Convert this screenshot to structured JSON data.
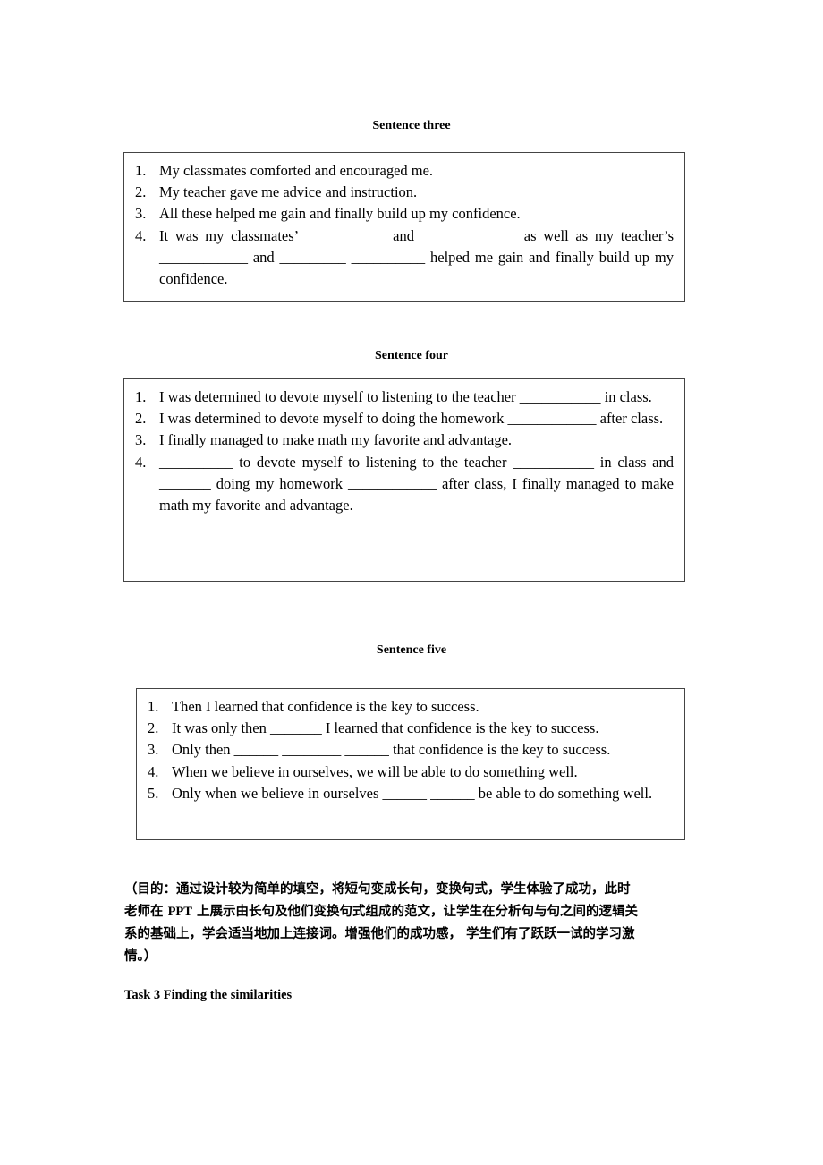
{
  "sections": [
    {
      "heading": "Sentence three",
      "items": [
        {
          "num": "1.",
          "text": "My classmates comforted and encouraged me."
        },
        {
          "num": "2.",
          "text": "My teacher gave me advice and instruction."
        },
        {
          "num": "3.",
          "text": "All these helped me gain and finally build up my confidence."
        },
        {
          "num": "4.",
          "text": "It was my classmates’ ___________ and _____________ as well as my teacher’s ____________ and _________ __________ helped me gain and finally build up my confidence."
        }
      ]
    },
    {
      "heading": "Sentence four",
      "items": [
        {
          "num": "1.",
          "text": "I was determined to devote myself to listening to the teacher ___________ in class."
        },
        {
          "num": "2.",
          "text": "I was determined to devote myself to doing the homework ____________ after class."
        },
        {
          "num": "3.",
          "text": "I finally managed to make math my favorite and advantage."
        },
        {
          "num": "4.",
          "text": "__________ to devote myself to listening to the teacher ___________ in class and _______ doing my homework ____________ after class, I finally managed to make math my favorite and advantage."
        }
      ]
    },
    {
      "heading": "Sentence five",
      "items": [
        {
          "num": "1.",
          "text": "Then I learned that confidence is the key to success."
        },
        {
          "num": "2.",
          "text": "It was only then _______ I learned that confidence is the key to success."
        },
        {
          "num": "3.",
          "text": "Only then ______ ________ ______ that confidence is the key to success."
        },
        {
          "num": "4.",
          "text": "When we believe in ourselves, we will be able to do something well."
        },
        {
          "num": "5.",
          "text": "Only when we believe in ourselves ______ ______ be able to do something well."
        }
      ]
    }
  ],
  "note": {
    "line1": "（目的：通过设计较为简单的填空，将短句变成长句，变换句式，学生体验了成功，此时",
    "line2_pre": "老师在 ",
    "line2_ppt": "PPT",
    "line2_post": " 上展示由长句及他们变换句式组成的范文，让学生在分析句与句之间的逻辑关",
    "line3": "系的基础上，学会适当地加上连接词。增强他们的成功感， 学生们有了跃跃一试的学习激",
    "line4": "情。）"
  },
  "task": "Task 3 Finding the similarities"
}
